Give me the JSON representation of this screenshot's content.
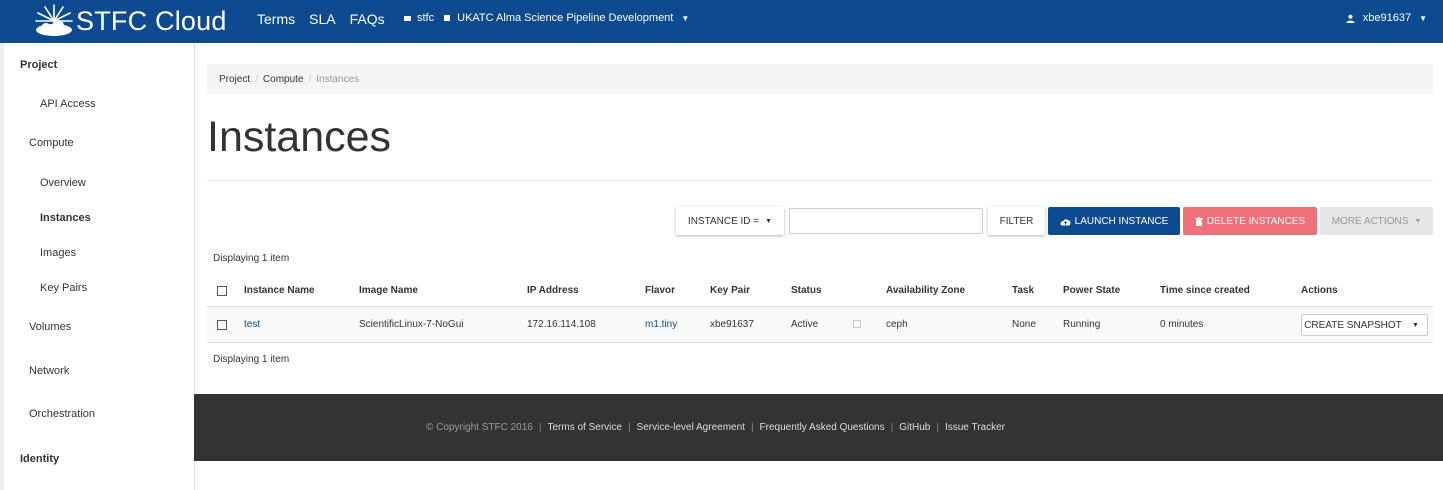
{
  "brand": {
    "name": "STFC Cloud"
  },
  "topnav": {
    "terms": "Terms",
    "sla": "SLA",
    "faqs": "FAQs"
  },
  "project": {
    "domain": "stfc",
    "name": "UKATC Alma Science Pipeline Development"
  },
  "user": {
    "name": "xbe91637"
  },
  "sidebar": {
    "project": "Project",
    "api_access": "API Access",
    "compute": "Compute",
    "overview": "Overview",
    "instances": "Instances",
    "images": "Images",
    "key_pairs": "Key Pairs",
    "volumes": "Volumes",
    "network": "Network",
    "orchestration": "Orchestration",
    "identity": "Identity"
  },
  "breadcrumb": {
    "project": "Project",
    "compute": "Compute",
    "current": "Instances"
  },
  "page_title": "Instances",
  "toolbar": {
    "filter_field": "INSTANCE ID =",
    "search_value": "",
    "filter": "FILTER",
    "launch": "LAUNCH INSTANCE",
    "delete": "DELETE INSTANCES",
    "more": "MORE ACTIONS"
  },
  "table": {
    "count_top": "Displaying 1 item",
    "count_bottom": "Displaying 1 item",
    "headers": {
      "name": "Instance Name",
      "image": "Image Name",
      "ip": "IP Address",
      "flavor": "Flavor",
      "key_pair": "Key Pair",
      "status": "Status",
      "az": "Availability Zone",
      "task": "Task",
      "power": "Power State",
      "time": "Time since created",
      "actions": "Actions"
    },
    "rows": [
      {
        "name": "test",
        "image": "ScientificLinux-7-NoGui",
        "ip": "172.16.114.108",
        "flavor": "m1.tiny",
        "key_pair": "xbe91637",
        "status": "Active",
        "az": "ceph",
        "task": "None",
        "power": "Running",
        "time": "0 minutes",
        "action": "CREATE SNAPSHOT"
      }
    ]
  },
  "footer": {
    "copyright": "© Copyright STFC 2016",
    "links": [
      "Terms of Service",
      "Service-level Agreement",
      "Frequently Asked Questions",
      "GitHub",
      "Issue Tracker"
    ]
  }
}
